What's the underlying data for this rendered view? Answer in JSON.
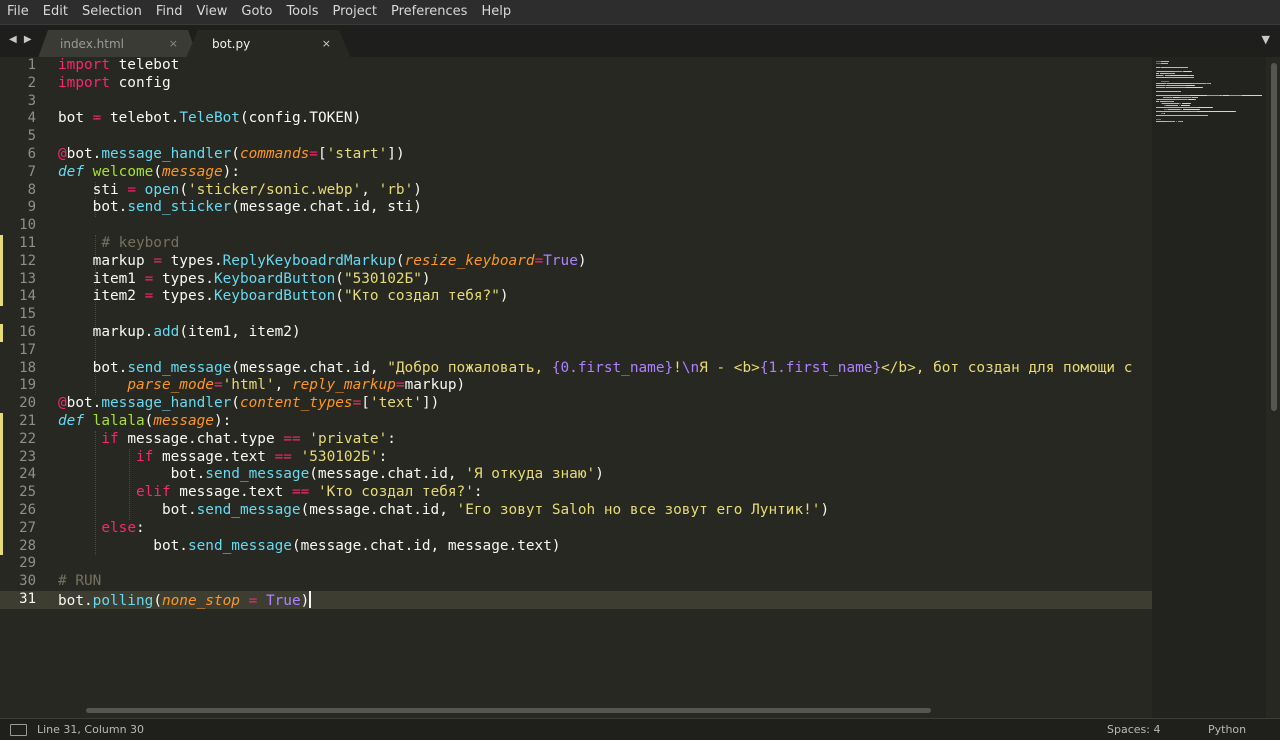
{
  "menu": [
    "File",
    "Edit",
    "Selection",
    "Find",
    "View",
    "Goto",
    "Tools",
    "Project",
    "Preferences",
    "Help"
  ],
  "tabs": [
    {
      "label": "index.html",
      "close": "×",
      "active": false
    },
    {
      "label": "bot.py",
      "close": "×",
      "active": true
    }
  ],
  "nav_arrows": "◀ ▶",
  "tab_dropdown": "▼",
  "colors": {
    "background": "#272822",
    "keyword": "#f92672",
    "function": "#a6e22e",
    "builtin": "#66d9ef",
    "string": "#e6db74",
    "argument": "#fd971f",
    "constant": "#ae81ff",
    "comment": "#75715e"
  },
  "editor": {
    "line_numbers": [
      "1",
      "2",
      "3",
      "4",
      "5",
      "6",
      "7",
      "8",
      "9",
      "10",
      "11",
      "12",
      "13",
      "14",
      "15",
      "16",
      "17",
      "18",
      "19",
      "20",
      "21",
      "22",
      "23",
      "24",
      "25",
      "26",
      "27",
      "28",
      "29",
      "30",
      "31"
    ],
    "active_line": 31,
    "modified_lines": [
      11,
      12,
      13,
      14,
      16,
      21,
      22,
      23,
      24,
      25,
      26,
      27,
      28
    ],
    "lines": [
      [
        [
          "kw",
          "import"
        ],
        [
          "plain",
          " telebot"
        ]
      ],
      [
        [
          "kw",
          "import"
        ],
        [
          "plain",
          " config"
        ]
      ],
      [],
      [
        [
          "plain",
          "bot "
        ],
        [
          "kw",
          "="
        ],
        [
          "plain",
          " telebot."
        ],
        [
          "call",
          "TeleBot"
        ],
        [
          "plain",
          "(config.TOKEN)"
        ]
      ],
      [],
      [
        [
          "deco",
          "@"
        ],
        [
          "plain",
          "bot."
        ],
        [
          "call",
          "message_handler"
        ],
        [
          "plain",
          "("
        ],
        [
          "arg",
          "commands"
        ],
        [
          "kw",
          "="
        ],
        [
          "plain",
          "["
        ],
        [
          "str",
          "'start'"
        ],
        [
          "plain",
          "])"
        ]
      ],
      [
        [
          "def",
          "def"
        ],
        [
          "plain",
          " "
        ],
        [
          "fn",
          "welcome"
        ],
        [
          "plain",
          "("
        ],
        [
          "arg",
          "message"
        ],
        [
          "plain",
          "):"
        ]
      ],
      [
        [
          "plain",
          "    sti "
        ],
        [
          "kw",
          "="
        ],
        [
          "plain",
          " "
        ],
        [
          "call",
          "open"
        ],
        [
          "plain",
          "("
        ],
        [
          "str",
          "'sticker/sonic.webp'"
        ],
        [
          "plain",
          ", "
        ],
        [
          "str",
          "'rb'"
        ],
        [
          "plain",
          ")"
        ]
      ],
      [
        [
          "plain",
          "    bot."
        ],
        [
          "call",
          "send_sticker"
        ],
        [
          "plain",
          "(message.chat.id, sti)"
        ]
      ],
      [],
      [
        [
          "plain",
          "     "
        ],
        [
          "cmt",
          "# keybord"
        ]
      ],
      [
        [
          "plain",
          "    markup "
        ],
        [
          "kw",
          "="
        ],
        [
          "plain",
          " types."
        ],
        [
          "call",
          "ReplyKeyboadrdMarkup"
        ],
        [
          "plain",
          "("
        ],
        [
          "arg",
          "resize_keyboard"
        ],
        [
          "kw",
          "="
        ],
        [
          "const",
          "True"
        ],
        [
          "plain",
          ")"
        ]
      ],
      [
        [
          "plain",
          "    item1 "
        ],
        [
          "kw",
          "="
        ],
        [
          "plain",
          " types."
        ],
        [
          "call",
          "KeyboardButton"
        ],
        [
          "plain",
          "("
        ],
        [
          "str",
          "\"530102Б\""
        ],
        [
          "plain",
          ")"
        ]
      ],
      [
        [
          "plain",
          "    item2 "
        ],
        [
          "kw",
          "="
        ],
        [
          "plain",
          " types."
        ],
        [
          "call",
          "KeyboardButton"
        ],
        [
          "plain",
          "("
        ],
        [
          "str",
          "\"Кто создал тебя?\""
        ],
        [
          "plain",
          ")"
        ]
      ],
      [],
      [
        [
          "plain",
          "    markup."
        ],
        [
          "call",
          "add"
        ],
        [
          "plain",
          "(item1, item2)"
        ]
      ],
      [],
      [
        [
          "plain",
          "    bot."
        ],
        [
          "call",
          "send_message"
        ],
        [
          "plain",
          "(message.chat.id, "
        ],
        [
          "str",
          "\"Добро пожаловать, "
        ],
        [
          "const",
          "{0.first_name}"
        ],
        [
          "str",
          "!"
        ],
        [
          "const",
          "\\n"
        ],
        [
          "str",
          "Я - <b>"
        ],
        [
          "const",
          "{1.first_name}"
        ],
        [
          "str",
          "</b>, бот создан для помощи с"
        ]
      ],
      [
        [
          "plain",
          "        "
        ],
        [
          "arg",
          "parse_mode"
        ],
        [
          "kw",
          "="
        ],
        [
          "str",
          "'html'"
        ],
        [
          "plain",
          ", "
        ],
        [
          "arg",
          "reply_markup"
        ],
        [
          "kw",
          "="
        ],
        [
          "plain",
          "markup)"
        ]
      ],
      [
        [
          "deco",
          "@"
        ],
        [
          "plain",
          "bot."
        ],
        [
          "call",
          "message_handler"
        ],
        [
          "plain",
          "("
        ],
        [
          "arg",
          "content_types"
        ],
        [
          "kw",
          "="
        ],
        [
          "plain",
          "["
        ],
        [
          "str",
          "'text'"
        ],
        [
          "plain",
          "])"
        ]
      ],
      [
        [
          "def",
          "def"
        ],
        [
          "plain",
          " "
        ],
        [
          "fn",
          "lalala"
        ],
        [
          "plain",
          "("
        ],
        [
          "arg",
          "message"
        ],
        [
          "plain",
          "):"
        ]
      ],
      [
        [
          "plain",
          "     "
        ],
        [
          "kw",
          "if"
        ],
        [
          "plain",
          " message.chat.type "
        ],
        [
          "kw",
          "=="
        ],
        [
          "plain",
          " "
        ],
        [
          "str",
          "'private'"
        ],
        [
          "plain",
          ":"
        ]
      ],
      [
        [
          "plain",
          "         "
        ],
        [
          "kw",
          "if"
        ],
        [
          "plain",
          " message.text "
        ],
        [
          "kw",
          "=="
        ],
        [
          "plain",
          " "
        ],
        [
          "str",
          "'530102Б'"
        ],
        [
          "plain",
          ":"
        ]
      ],
      [
        [
          "plain",
          "             bot."
        ],
        [
          "call",
          "send_message"
        ],
        [
          "plain",
          "(message.chat.id, "
        ],
        [
          "str",
          "'Я откуда знаю'"
        ],
        [
          "plain",
          ")"
        ]
      ],
      [
        [
          "plain",
          "         "
        ],
        [
          "kw",
          "elif"
        ],
        [
          "plain",
          " message.text "
        ],
        [
          "kw",
          "=="
        ],
        [
          "plain",
          " "
        ],
        [
          "str",
          "'Кто создал тебя?'"
        ],
        [
          "plain",
          ":"
        ]
      ],
      [
        [
          "plain",
          "            bot."
        ],
        [
          "call",
          "send_message"
        ],
        [
          "plain",
          "(message.chat.id, "
        ],
        [
          "str",
          "'Его зовут Saloh но все зовут его Лунтик!'"
        ],
        [
          "plain",
          ")"
        ]
      ],
      [
        [
          "plain",
          "     "
        ],
        [
          "kw",
          "else"
        ],
        [
          "plain",
          ":"
        ]
      ],
      [
        [
          "plain",
          "           bot."
        ],
        [
          "call",
          "send_message"
        ],
        [
          "plain",
          "(message.chat.id, message.text)"
        ]
      ],
      [],
      [
        [
          "cmt",
          "# RUN"
        ]
      ],
      [
        [
          "plain",
          "bot."
        ],
        [
          "call",
          "polling"
        ],
        [
          "plain",
          "("
        ],
        [
          "arg",
          "none_stop"
        ],
        [
          "plain",
          " "
        ],
        [
          "kw",
          "="
        ],
        [
          "plain",
          " "
        ],
        [
          "const",
          "True"
        ],
        [
          "plain",
          ")"
        ]
      ]
    ]
  },
  "status": {
    "position": "Line 31, Column 30",
    "spaces": "Spaces: 4",
    "language": "Python"
  }
}
